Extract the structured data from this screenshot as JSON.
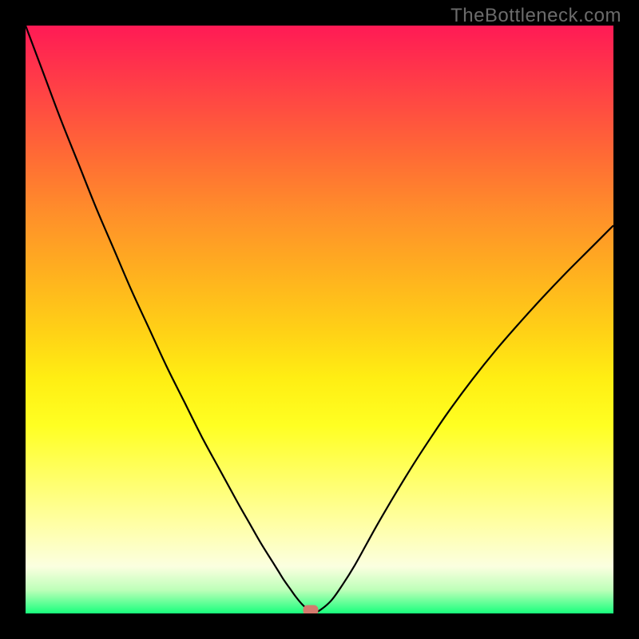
{
  "watermark": "TheBottleneck.com",
  "colors": {
    "frame_bg": "#000000",
    "curve_stroke": "#000000",
    "marker_fill": "#d47a6e",
    "gradient_top": "#ff1a55",
    "gradient_bottom": "#18ff7c"
  },
  "chart_data": {
    "type": "line",
    "title": "",
    "xlabel": "",
    "ylabel": "",
    "xlim": [
      0,
      100
    ],
    "ylim": [
      0,
      100
    ],
    "x": [
      0,
      3,
      6,
      9,
      12,
      15,
      18,
      21,
      24,
      27,
      30,
      33,
      36,
      38,
      40,
      42,
      43,
      44,
      45,
      46,
      47,
      48,
      49,
      50,
      52,
      54,
      56,
      58,
      60,
      63,
      66,
      69,
      72,
      76,
      80,
      84,
      88,
      92,
      96,
      100
    ],
    "values": [
      100,
      92,
      84,
      76.5,
      69,
      62,
      55,
      48.5,
      42,
      36,
      30,
      24.5,
      19,
      15.5,
      12,
      8.8,
      7.2,
      5.6,
      4.2,
      2.8,
      1.6,
      0.7,
      0.2,
      0.5,
      2.2,
      5.0,
      8.2,
      11.8,
      15.4,
      20.5,
      25.4,
      30.0,
      34.4,
      39.8,
      44.8,
      49.4,
      53.8,
      58.0,
      62.0,
      66.0
    ],
    "marker": {
      "x": 48.5,
      "y": 0,
      "shape": "rounded-rect"
    },
    "grid": false,
    "legend": false
  }
}
